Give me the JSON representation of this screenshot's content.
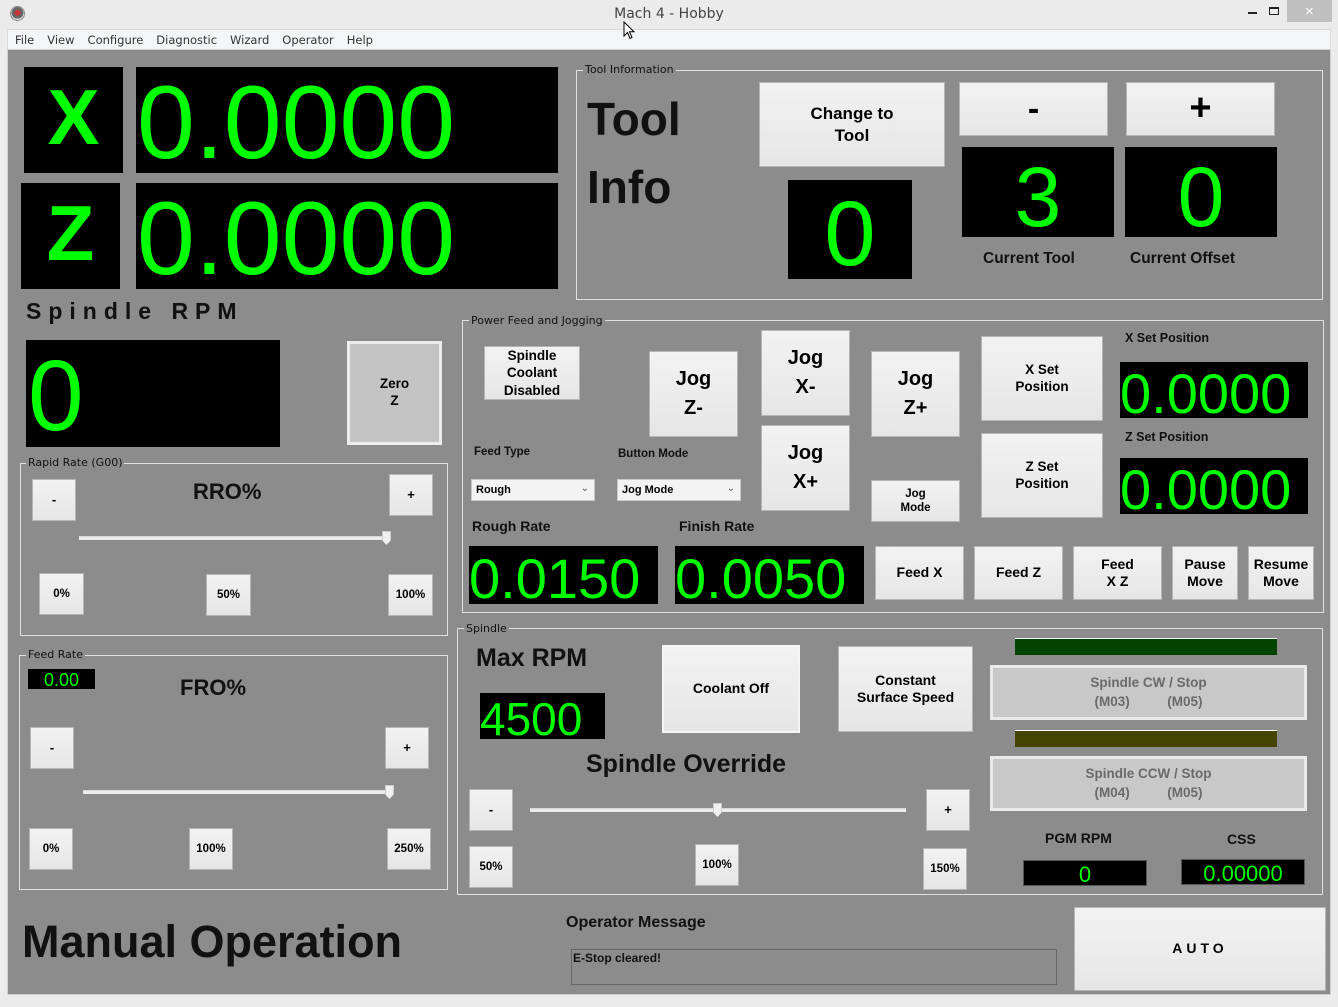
{
  "window": {
    "title": "Mach 4 - Hobby",
    "close_icon": "×"
  },
  "menu": [
    "File",
    "View",
    "Configure",
    "Diagnostic",
    "Wizard",
    "Operator",
    "Help"
  ],
  "dro": {
    "x_label": "X",
    "x_value": "0.0000",
    "z_label": "Z",
    "z_value": "0.0000"
  },
  "spindle_rpm": {
    "title": "Spindle RPM",
    "value": "0",
    "zero_z_button": "Zero\nZ"
  },
  "tool_info": {
    "group_label": "Tool Information",
    "heading_line1": "Tool",
    "heading_line2": "Info",
    "change_to_tool_button": "Change to\nTool",
    "change_to_tool_value": "0",
    "minus_button": "-",
    "plus_button": "+",
    "current_tool_value": "3",
    "current_offset_value": "0",
    "current_tool_label": "Current Tool",
    "current_offset_label": "Current Offset"
  },
  "rapid_rate": {
    "group_label": "Rapid Rate (G00)",
    "title": "RRO%",
    "minus_button": "-",
    "plus_button": "+",
    "preset_buttons": [
      "0%",
      "50%",
      "100%"
    ],
    "slider_percent_of_range": 100
  },
  "feed_rate": {
    "group_label": "Feed Rate",
    "value": "0.00",
    "title": "FRO%",
    "minus_button": "-",
    "plus_button": "+",
    "preset_buttons": [
      "0%",
      "100%",
      "250%"
    ],
    "slider_percent_of_range": 100
  },
  "power_feed": {
    "group_label": "Power Feed and Jogging",
    "spindle_coolant_button": "Spindle\nCoolant\nDisabled",
    "jog_z_minus": "Jog\nZ-",
    "jog_x_minus": "Jog\nX-",
    "jog_x_plus": "Jog\nX+",
    "jog_z_plus": "Jog\nZ+",
    "jog_mode_button": "Jog\nMode",
    "feed_type_label": "Feed Type",
    "feed_type_value": "Rough",
    "button_mode_label": "Button Mode",
    "button_mode_value": "Jog Mode",
    "rough_rate_label": "Rough Rate",
    "rough_rate_value": "0.0150",
    "finish_rate_label": "Finish Rate",
    "finish_rate_value": "0.0050",
    "x_set_position_button": "X Set\nPosition",
    "z_set_position_button": "Z Set\nPosition",
    "x_set_position_label": "X Set Position",
    "x_set_position_value": "0.0000",
    "z_set_position_label": "Z Set Position",
    "z_set_position_value": "0.0000",
    "feed_x_button": "Feed X",
    "feed_z_button": "Feed Z",
    "feed_xz_button": "Feed\nX Z",
    "pause_move_button": "Pause\nMove",
    "resume_move_button": "Resume\nMove"
  },
  "spindle": {
    "group_label": "Spindle",
    "max_rpm_label": "Max RPM",
    "max_rpm_value": "4500",
    "coolant_button": "Coolant Off",
    "css_button": "Constant\nSurface Speed",
    "override_title": "Spindle Override",
    "minus_button": "-",
    "plus_button": "+",
    "preset_buttons": [
      "50%",
      "100%",
      "150%"
    ],
    "override_slider_percent": 100,
    "override_slider_range": [
      50,
      150
    ],
    "cw_indicator_color": "#004400",
    "ccw_indicator_color": "#444400",
    "cw_button": "Spindle CW / Stop\n(M03)          (M05)",
    "ccw_button": "Spindle CCW / Stop\n(M04)          (M05)",
    "pgm_rpm_label": "PGM RPM",
    "pgm_rpm_value": "0",
    "css_label": "CSS",
    "css_value": "0.00000"
  },
  "footer": {
    "mode_title": "Manual Operation",
    "operator_message_label": "Operator Message",
    "operator_message": "E-Stop cleared!",
    "auto_button": "AUTO"
  },
  "colors": {
    "panel_bg": "#8c8c8c",
    "dro_fg": "#00ff00",
    "dro_bg": "#000000"
  }
}
